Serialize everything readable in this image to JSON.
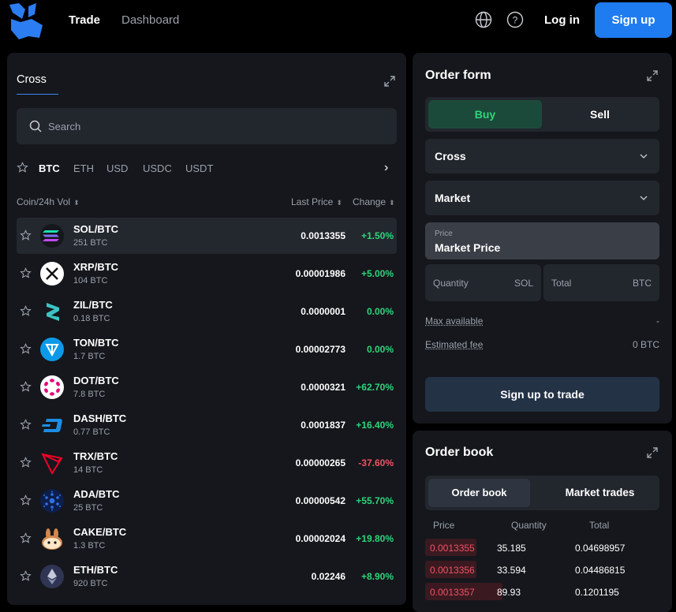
{
  "nav": {
    "trade": "Trade",
    "dashboard": "Dashboard",
    "login": "Log in",
    "signup": "Sign up"
  },
  "market": {
    "tab": "Cross",
    "search_placeholder": "Search",
    "quotes": [
      "BTC",
      "ETH",
      "USD",
      "USDC",
      "USDT"
    ],
    "columns": {
      "coin": "Coin/24h Vol",
      "price": "Last Price",
      "change": "Change"
    },
    "rows": [
      {
        "pair": "SOL/BTC",
        "vol": "251 BTC",
        "price": "0.0013355",
        "change": "+1.50%",
        "dir": "pos",
        "icon": "sol-icon",
        "selected": true
      },
      {
        "pair": "XRP/BTC",
        "vol": "104 BTC",
        "price": "0.00001986",
        "change": "+5.00%",
        "dir": "pos",
        "icon": "xrp-icon"
      },
      {
        "pair": "ZIL/BTC",
        "vol": "0.18 BTC",
        "price": "0.0000001",
        "change": "0.00%",
        "dir": "pos",
        "icon": "zil-icon"
      },
      {
        "pair": "TON/BTC",
        "vol": "1.7 BTC",
        "price": "0.00002773",
        "change": "0.00%",
        "dir": "pos",
        "icon": "ton-icon"
      },
      {
        "pair": "DOT/BTC",
        "vol": "7.8 BTC",
        "price": "0.0000321",
        "change": "+62.70%",
        "dir": "pos",
        "icon": "dot-icon"
      },
      {
        "pair": "DASH/BTC",
        "vol": "0.77 BTC",
        "price": "0.0001837",
        "change": "+16.40%",
        "dir": "pos",
        "icon": "dash-icon"
      },
      {
        "pair": "TRX/BTC",
        "vol": "14 BTC",
        "price": "0.00000265",
        "change": "-37.60%",
        "dir": "neg",
        "icon": "trx-icon"
      },
      {
        "pair": "ADA/BTC",
        "vol": "25 BTC",
        "price": "0.00000542",
        "change": "+55.70%",
        "dir": "pos",
        "icon": "ada-icon"
      },
      {
        "pair": "CAKE/BTC",
        "vol": "1.3 BTC",
        "price": "0.00002024",
        "change": "+19.80%",
        "dir": "pos",
        "icon": "cake-icon"
      },
      {
        "pair": "ETH/BTC",
        "vol": "920 BTC",
        "price": "0.02246",
        "change": "+8.90%",
        "dir": "pos",
        "icon": "eth-icon"
      }
    ]
  },
  "order_form": {
    "title": "Order form",
    "buy": "Buy",
    "sell": "Sell",
    "margin": "Cross",
    "order_type": "Market",
    "price_caption": "Price",
    "price_value": "Market Price",
    "quantity": "Quantity",
    "quantity_unit": "SOL",
    "total": "Total",
    "total_unit": "BTC",
    "max_available": "Max available",
    "max_available_value": "-",
    "est_fee": "Estimated fee",
    "est_fee_value": "0 BTC",
    "cta": "Sign up to trade"
  },
  "order_book": {
    "title": "Order book",
    "tabs": [
      "Order book",
      "Market trades"
    ],
    "columns": [
      "Price",
      "Quantity",
      "Total"
    ],
    "rows": [
      {
        "price": "0.0013355",
        "qty": "35.185",
        "total": "0.04698957",
        "depth": 0.22
      },
      {
        "price": "0.0013356",
        "qty": "33.594",
        "total": "0.04486815",
        "depth": 0.22
      },
      {
        "price": "0.0013357",
        "qty": "89.93",
        "total": "0.1201195",
        "depth": 0.33
      }
    ]
  },
  "colors": {
    "accent": "#1f7cf0",
    "positive": "#2ed47a",
    "negative": "#f05264",
    "panel": "#15171c"
  }
}
